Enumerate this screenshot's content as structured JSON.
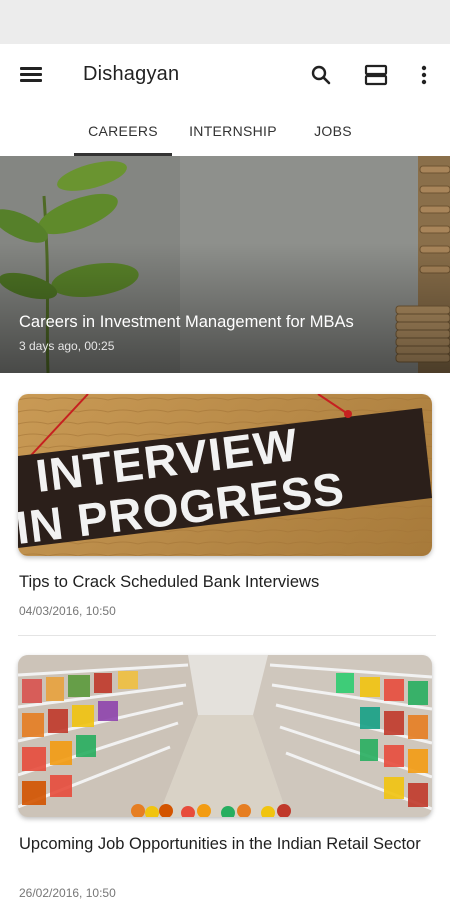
{
  "app": {
    "title": "Dishagyan"
  },
  "toolbar": {
    "menu_icon": "hamburger-menu-icon",
    "search_icon": "search-icon",
    "view_icon": "view-toggle-icon",
    "more_icon": "more-vertical-icon"
  },
  "tabs": [
    {
      "label": "CAREERS",
      "selected": true
    },
    {
      "label": "INTERNSHIP",
      "selected": false
    },
    {
      "label": "JOBS",
      "selected": false
    }
  ],
  "featured": {
    "title": "Careers in Investment Management for MBAs",
    "timestamp": "3 days ago, 00:25"
  },
  "articles": [
    {
      "title": "Tips to Crack Scheduled Bank Interviews",
      "timestamp": "04/03/2016, 10:50",
      "image_text": [
        "INTERVIEW",
        "IN PROGRESS"
      ]
    },
    {
      "title": "Upcoming Job Opportunities in the Indian Retail Sector",
      "timestamp": "26/02/2016, 10:50"
    }
  ],
  "colors": {
    "status_bar": "#ececec",
    "tab_indicator": "#333333",
    "text_primary": "#212121",
    "text_secondary": "#777777"
  }
}
